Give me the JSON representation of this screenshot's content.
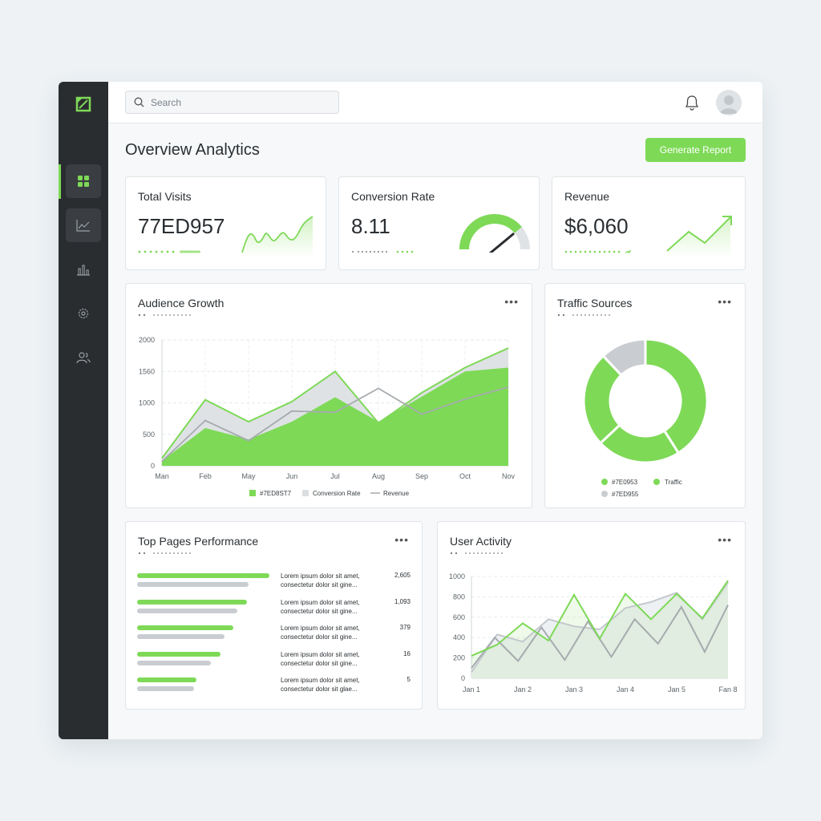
{
  "search": {
    "placeholder": "Search"
  },
  "page": {
    "title": "Overview Analytics",
    "generate_label": "Generate Report"
  },
  "colors": {
    "accent": "#7ed957",
    "sidebar": "#2a2d30",
    "grey_series": "#c9cdd1",
    "line_series": "#a6abaf"
  },
  "sidebar": {
    "items": [
      {
        "icon": "dashboard-grid-icon"
      },
      {
        "icon": "line-chart-icon"
      },
      {
        "icon": "bar-chart-icon"
      },
      {
        "icon": "settings-gear-icon"
      },
      {
        "icon": "users-icon"
      }
    ]
  },
  "kpis": {
    "visits": {
      "title": "Total Visits",
      "value": "77ED957"
    },
    "conversion": {
      "title": "Conversion Rate",
      "value": "8.11",
      "gauge_fraction": 0.78
    },
    "revenue": {
      "title": "Revenue",
      "value": "$6,060"
    }
  },
  "audience": {
    "title": "Audience Growth",
    "chart_data": {
      "type": "area",
      "categories": [
        "Man",
        "Feb",
        "May",
        "Jun",
        "Jul",
        "Aug",
        "Sep",
        "Oct",
        "Nov"
      ],
      "yticks": [
        "2000",
        "1560",
        "1000",
        "500",
        "0"
      ],
      "ylim": [
        0,
        2000
      ],
      "series": [
        {
          "name": "#7ED8ST7",
          "values": [
            80,
            600,
            420,
            700,
            1090,
            700,
            1100,
            1500,
            1560
          ]
        },
        {
          "name": "Conversion Rate",
          "values": [
            120,
            1050,
            700,
            1020,
            1500,
            680,
            1160,
            1560,
            1870
          ]
        },
        {
          "name": "Revenue",
          "values": [
            70,
            720,
            400,
            870,
            850,
            1230,
            820,
            1060,
            1250
          ]
        }
      ],
      "legend_position": "bottom"
    }
  },
  "traffic": {
    "title": "Traffic Sources",
    "chart_data": {
      "type": "pie",
      "labels": [
        "#7E0953",
        "Traffic",
        "#7ED955"
      ],
      "values": [
        41,
        22,
        25,
        12
      ]
    },
    "legend": [
      {
        "label": "#7E0953",
        "color": "#7ed957"
      },
      {
        "label": "Traffic",
        "color": "#7ed957"
      },
      {
        "label": "#7ED955",
        "color": "#c9cdd1"
      }
    ]
  },
  "top_pages": {
    "title": "Top Pages Performance",
    "rows": [
      {
        "line1": "Lorem ipsum dolor sit amet,",
        "line2": "consectetur dolor sit gine...",
        "value": "2,605",
        "green": 1.0,
        "grey": 0.84
      },
      {
        "line1": "Lorem ipsum dolor sit amet,",
        "line2": "consectetur dolor sit gine...",
        "value": "1,093",
        "green": 0.83,
        "grey": 0.76
      },
      {
        "line1": "Lorem ipsum dolor sit amet,",
        "line2": "consectetur dolor sit gine...",
        "value": "379",
        "green": 0.73,
        "grey": 0.66
      },
      {
        "line1": "Lorem ipsum dolor sit amet,",
        "line2": "consectetur dolor sit gine...",
        "value": "16",
        "green": 0.63,
        "grey": 0.56
      },
      {
        "line1": "Lorem ipsum dolor sit amet,",
        "line2": "consectetur dolor sit glae...",
        "value": "5",
        "green": 0.45,
        "grey": 0.43
      }
    ]
  },
  "user_activity": {
    "title": "User Activity",
    "chart_data": {
      "type": "line",
      "categories": [
        "Jan 1",
        "Jan 2",
        "Jan 3",
        "Jan 4",
        "Jan 5",
        "Fan 8"
      ],
      "yticks": [
        "1000",
        "800",
        "600",
        "400",
        "200",
        "0"
      ],
      "ylim": [
        0,
        1000
      ],
      "series": [
        {
          "values": [
            220,
            330,
            540,
            370,
            820,
            390,
            830,
            580,
            830,
            590,
            960
          ]
        },
        {
          "values": [
            60,
            430,
            360,
            580,
            510,
            480,
            690,
            750,
            840,
            580,
            940
          ]
        },
        {
          "values": [
            100,
            400,
            170,
            500,
            180,
            560,
            210,
            580,
            340,
            700,
            260,
            720
          ]
        }
      ]
    }
  }
}
